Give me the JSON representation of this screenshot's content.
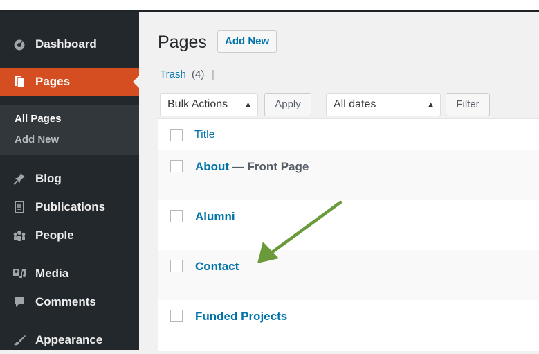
{
  "sidebar": {
    "items": [
      {
        "label": "Dashboard",
        "icon": "dashboard-icon"
      },
      {
        "label": "Pages",
        "icon": "pages-icon"
      },
      {
        "label": "Blog",
        "icon": "pin-icon"
      },
      {
        "label": "Publications",
        "icon": "document-icon"
      },
      {
        "label": "People",
        "icon": "people-icon"
      },
      {
        "label": "Media",
        "icon": "media-icon"
      },
      {
        "label": "Comments",
        "icon": "comments-icon"
      },
      {
        "label": "Appearance",
        "icon": "appearance-icon"
      }
    ],
    "submenu": {
      "all_pages": "All Pages",
      "add_new": "Add New"
    }
  },
  "main": {
    "title": "Pages",
    "add_new_label": "Add New",
    "trash": {
      "label": "Trash",
      "count": "(4)",
      "separator": "|"
    },
    "bulk_actions": {
      "selected": "Bulk Actions"
    },
    "apply_label": "Apply",
    "dates_filter": {
      "selected": "All dates"
    },
    "filter_label": "Filter",
    "table": {
      "column_title": "Title",
      "rows": [
        {
          "title": "About",
          "state": "— Front Page"
        },
        {
          "title": "Alumni",
          "state": ""
        },
        {
          "title": "Contact",
          "state": ""
        },
        {
          "title": "Funded Projects",
          "state": ""
        }
      ]
    }
  },
  "colors": {
    "accent": "#0073aa",
    "active_menu": "#d54e21",
    "sidebar_bg": "#23282d",
    "annotation_arrow": "#6a9a3a"
  }
}
